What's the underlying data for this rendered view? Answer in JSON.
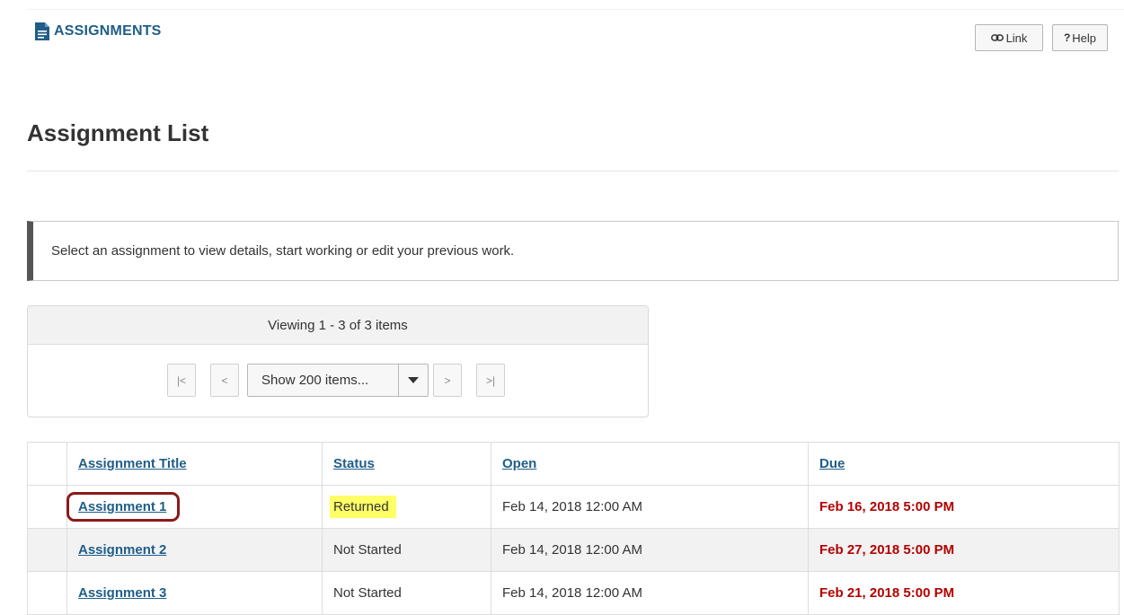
{
  "header": {
    "tool_title": "ASSIGNMENTS",
    "tool_icon": "document-icon",
    "link_button": "Link",
    "help_button": "Help",
    "help_glyph": "?"
  },
  "page_title": "Assignment List",
  "instruction": "Select an assignment to view details, start working or edit your previous work.",
  "pager": {
    "viewing": "Viewing 1 - 3 of 3 items",
    "first": "|<",
    "prev": "<",
    "next": ">",
    "last": ">|",
    "page_size": "Show 200 items..."
  },
  "table": {
    "columns": [
      "Assignment Title",
      "Status",
      "Open",
      "Due"
    ],
    "rows": [
      {
        "title": "Assignment 1",
        "status": "Returned",
        "open": "Feb 14, 2018 12:00 AM",
        "due": "Feb 16, 2018 5:00 PM"
      },
      {
        "title": "Assignment 2",
        "status": "Not Started",
        "open": "Feb 14, 2018 12:00 AM",
        "due": "Feb 27, 2018 5:00 PM"
      },
      {
        "title": "Assignment 3",
        "status": "Not Started",
        "open": "Feb 14, 2018 12:00 AM",
        "due": "Feb 21, 2018 5:00 PM"
      }
    ]
  },
  "colors": {
    "link": "#1f5e88",
    "due": "#b30000",
    "highlight": "#ffff66",
    "callout": "#8b1a1a"
  }
}
